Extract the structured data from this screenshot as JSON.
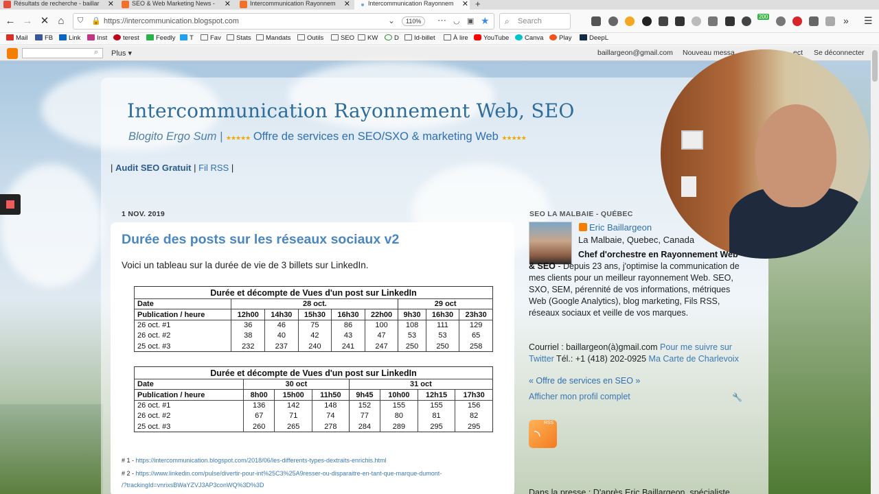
{
  "browser": {
    "tabs": [
      {
        "label": "Résultats de recherche - baillar"
      },
      {
        "label": "SEO & Web Marketing News -"
      },
      {
        "label": "Intercommunication Rayonnem"
      },
      {
        "label": "Intercommunication Rayonnem"
      }
    ],
    "new_tab": "+",
    "url": "https://intercommunication.blogspot.com",
    "zoom": "110%",
    "search_placeholder": "Search",
    "bookmarks": [
      "Mail",
      "FB",
      "Link",
      "Inst",
      "terest",
      "Feedly",
      "T",
      "Fav",
      "Stats",
      "Mandats",
      "Outils",
      "SEO",
      "KW",
      "D",
      "Id-billet",
      "À lire",
      "YouTube",
      "Canva",
      "Play",
      "DeepL"
    ],
    "badge_count": "200"
  },
  "blogger_bar": {
    "more": "Plus ▾",
    "email": "baillargeon@gmail.com",
    "new_post": "Nouveau messa",
    "design": "ect",
    "logout": "Se déconnecter"
  },
  "blog": {
    "title": "Intercommunication Rayonnement Web, SEO",
    "tagline": "Blogito Ergo Sum |",
    "offer": "Offre de services en SEO/SXO & marketing Web",
    "stars": "★★★★★",
    "links": {
      "sep": "|",
      "audit": "Audit SEO Gratuit",
      "rss": "Fil RSS"
    }
  },
  "post": {
    "date": "1 NOV. 2019",
    "title": "Durée des posts sur les réseaux sociaux v2",
    "intro": "Voici un tableau sur la durée de vie de 3 billets sur LinkedIn.",
    "table1": {
      "heading": "Durée et décompte de Vues d'un post sur LinkedIn",
      "date_label": "Date",
      "day1": "28 oct.",
      "day2": "29 oct",
      "row_label": "Publication / heure",
      "hours": [
        "12h00",
        "14h30",
        "15h30",
        "16h30",
        "22h00",
        "9h30",
        "16h30",
        "23h30"
      ],
      "rows": [
        {
          "label": "26 oct. #1",
          "values": [
            "36",
            "46",
            "75",
            "86",
            "100",
            "108",
            "111",
            "129"
          ]
        },
        {
          "label": "26 oct. #2",
          "values": [
            "38",
            "40",
            "42",
            "43",
            "47",
            "53",
            "53",
            "65"
          ]
        },
        {
          "label": "25 oct. #3",
          "values": [
            "232",
            "237",
            "240",
            "241",
            "247",
            "250",
            "250",
            "258"
          ]
        }
      ]
    },
    "table2": {
      "heading": "Durée et décompte de Vues d'un post sur LinkedIn",
      "date_label": "Date",
      "day1": "30 oct",
      "day2": "31 oct",
      "row_label": "Publication / heure",
      "hours": [
        "8h00",
        "15h00",
        "11h50",
        "9h45",
        "10h00",
        "12h15",
        "17h30"
      ],
      "rows": [
        {
          "label": "26 oct. #1",
          "values": [
            "136",
            "142",
            "148",
            "152",
            "155",
            "155",
            "156"
          ]
        },
        {
          "label": "26 oct. #2",
          "values": [
            "67",
            "71",
            "74",
            "77",
            "80",
            "81",
            "82"
          ]
        },
        {
          "label": "25 oct. #3",
          "values": [
            "260",
            "265",
            "278",
            "284",
            "289",
            "295",
            "295"
          ]
        }
      ]
    },
    "refs": [
      {
        "prefix": "# 1 - ",
        "url": "https://intercommunication.blogspot.com/2018/06/les-differents-types-dextraits-enrichis.html"
      },
      {
        "prefix": "# 2 - ",
        "url": "https://www.linkedin.com/pulse/divertir-pour-int%25C3%25A9resser-ou-disparaitre-en-tant-que-marque-dumont-"
      },
      {
        "prefix": "",
        "url": "/?trackingId=vnrixsBWaYZVJ3AP3conWQ%3D%3D"
      }
    ]
  },
  "sidebar": {
    "heading": "SEO LA MALBAIE - QUÉBEC",
    "name": "Eric Baillargeon",
    "location": "La Malbaie, Quebec, Canada",
    "bio_bold": "Chef d'orchestre en Rayonnement Web & SEO",
    "bio_text": " - Depuis 23 ans, j'optimise la communication de mes clients pour un meilleur rayonnement Web. SEO, SXO, SEM, pérennité de vos informations, métriques Web (Google Analytics), blog marketing, Fils RSS, réseaux sociaux et veille de vos marques.",
    "contact_text": "Courriel : baillargeon(à)gmail.com ",
    "contact_follow": "Pour me suivre sur Twitter",
    "contact_tel": " Tél.: +1 (418) 202-0925 ",
    "contact_map": "Ma Carte de Charlevoix",
    "offer_link": "« Offre de services en SEO »",
    "profile_link": "Afficher mon profil complet",
    "rss_label": "RSS",
    "press": "Dans la presse : D'après Eric Baillargeon, spécialiste"
  }
}
